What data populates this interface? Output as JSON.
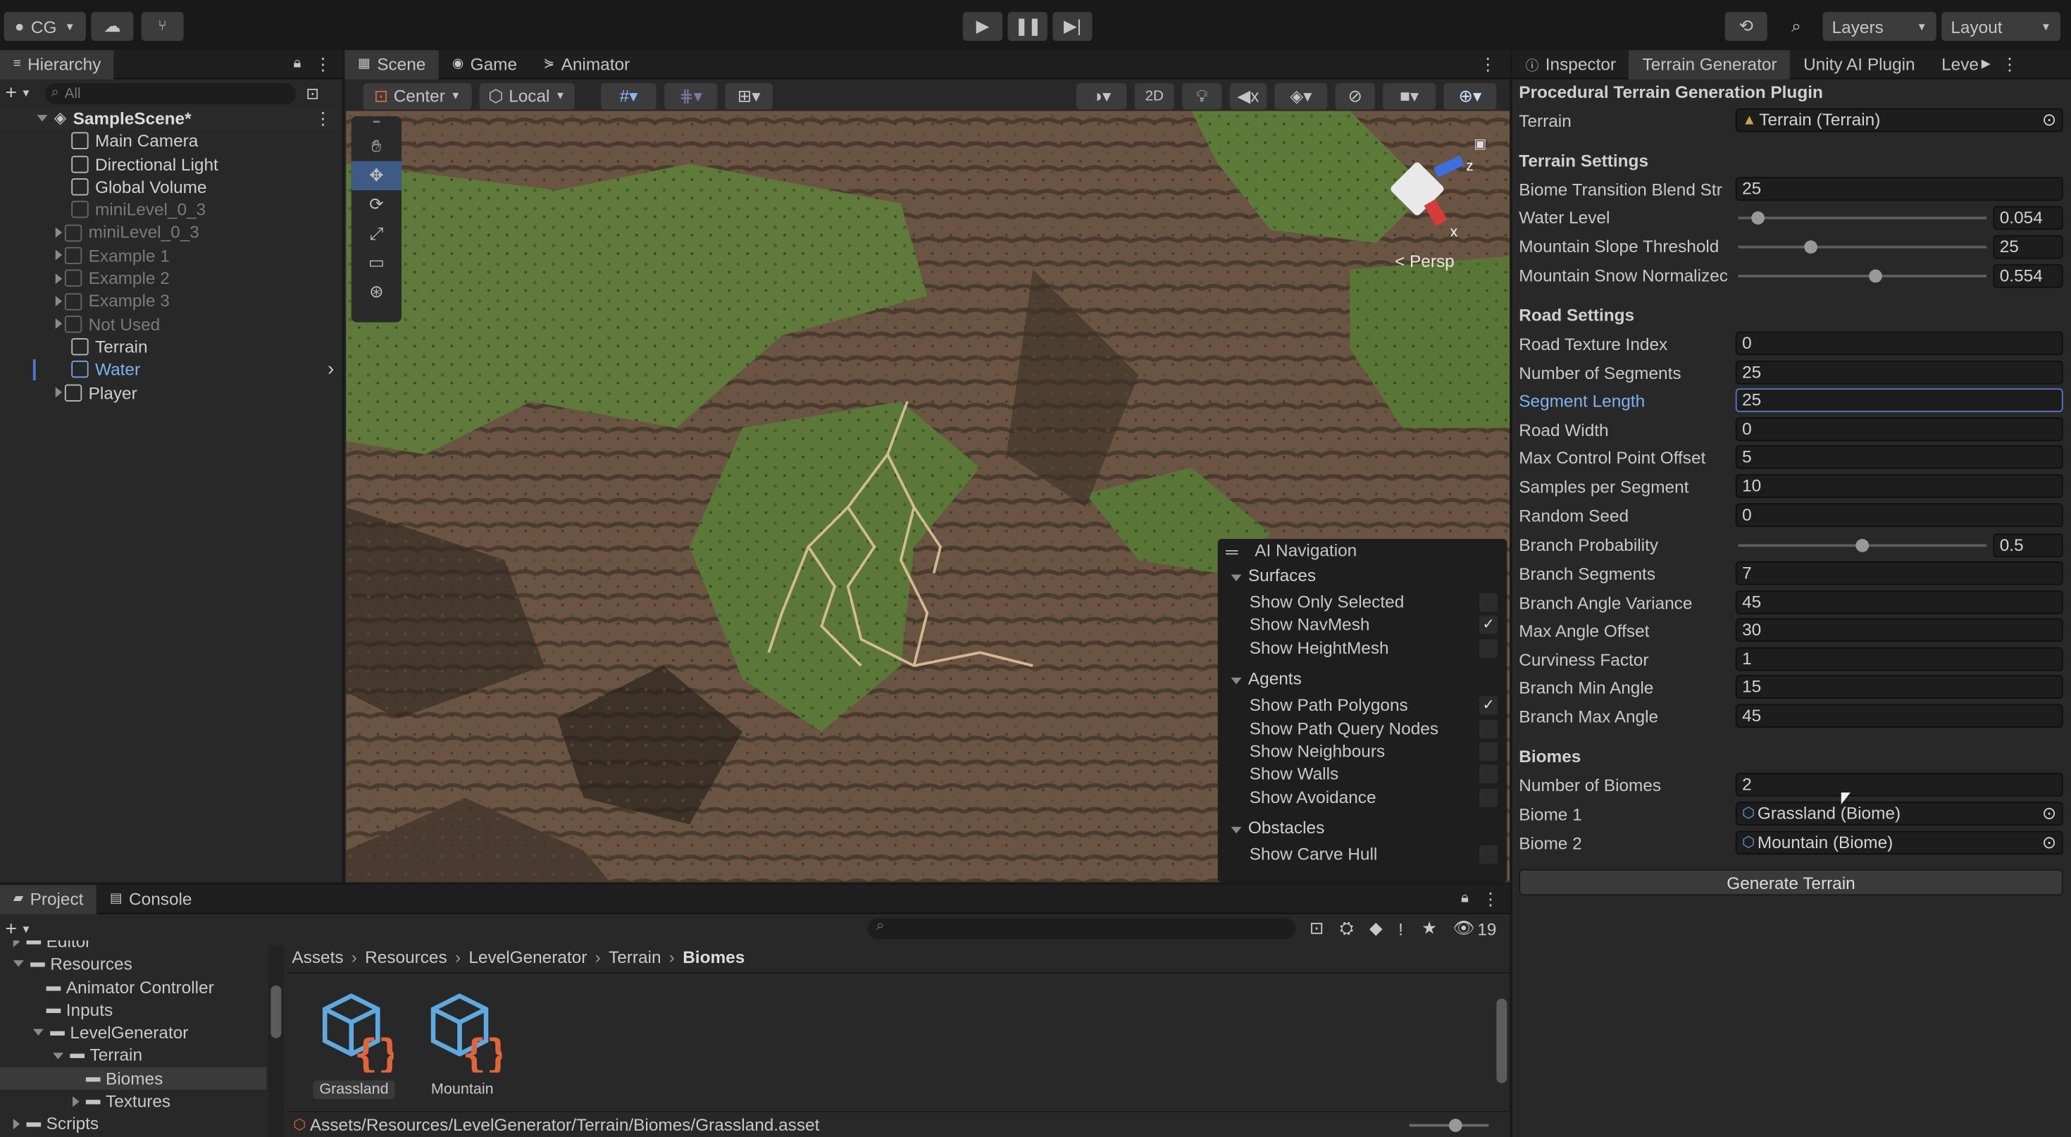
{
  "top": {
    "account": "CG",
    "layers": "Layers",
    "layout": "Layout"
  },
  "hierarchy": {
    "tab": "Hierarchy",
    "search_placeholder": "All",
    "scene": "SampleScene*",
    "items": [
      {
        "label": "Main Camera",
        "dim": false,
        "indent": 1,
        "arrow": false
      },
      {
        "label": "Directional Light",
        "dim": false,
        "indent": 1,
        "arrow": false
      },
      {
        "label": "Global Volume",
        "dim": false,
        "indent": 1,
        "arrow": false
      },
      {
        "label": "miniLevel_0_3",
        "dim": true,
        "indent": 1,
        "arrow": false
      },
      {
        "label": "miniLevel_0_3",
        "dim": true,
        "indent": 1,
        "arrow": true
      },
      {
        "label": "Example 1",
        "dim": true,
        "indent": 1,
        "arrow": true
      },
      {
        "label": "Example 2",
        "dim": true,
        "indent": 1,
        "arrow": true
      },
      {
        "label": "Example 3",
        "dim": true,
        "indent": 1,
        "arrow": true
      },
      {
        "label": "Not Used",
        "dim": true,
        "indent": 1,
        "arrow": true
      },
      {
        "label": "Terrain",
        "dim": false,
        "indent": 1,
        "arrow": false
      },
      {
        "label": "Water",
        "dim": false,
        "indent": 1,
        "arrow": false,
        "selected": true
      },
      {
        "label": "Player",
        "dim": false,
        "indent": 1,
        "arrow": true
      }
    ]
  },
  "scene_tabs": [
    "Scene",
    "Game",
    "Animator"
  ],
  "scene_toolbar": {
    "pivot": "Center",
    "space": "Local",
    "mode2d": "2D"
  },
  "gizmo": {
    "persp": "< Persp",
    "x": "x",
    "z": "z"
  },
  "ai_nav": {
    "title": "AI Navigation",
    "surfaces": {
      "label": "Surfaces",
      "items": [
        {
          "label": "Show Only Selected",
          "checked": false
        },
        {
          "label": "Show NavMesh",
          "checked": true
        },
        {
          "label": "Show HeightMesh",
          "checked": false
        }
      ]
    },
    "agents": {
      "label": "Agents",
      "items": [
        {
          "label": "Show Path Polygons",
          "checked": true
        },
        {
          "label": "Show Path Query Nodes",
          "checked": false
        },
        {
          "label": "Show Neighbours",
          "checked": false
        },
        {
          "label": "Show Walls",
          "checked": false
        },
        {
          "label": "Show Avoidance",
          "checked": false
        }
      ]
    },
    "obstacles": {
      "label": "Obstacles",
      "items": [
        {
          "label": "Show Carve Hull",
          "checked": false
        }
      ]
    }
  },
  "inspector": {
    "tabs": [
      "Inspector",
      "Terrain Generator",
      "Unity AI Plugin",
      "Leve"
    ],
    "plugin_title": "Procedural Terrain Generation Plugin",
    "terrain_label": "Terrain",
    "terrain_value": "Terrain (Terrain)",
    "terrain_settings": "Terrain Settings",
    "biome_blend_label": "Biome Transition Blend Str",
    "biome_blend_value": "25",
    "water_label": "Water Level",
    "water_value": "0.054",
    "water_frac": 0.054,
    "slope_label": "Mountain Slope Threshold",
    "slope_value": "25",
    "slope_frac": 0.28,
    "snow_label": "Mountain Snow Normalizec",
    "snow_value": "0.554",
    "snow_frac": 0.554,
    "road_settings": "Road Settings",
    "road_fields": [
      {
        "label": "Road Texture Index",
        "value": "0"
      },
      {
        "label": "Number of Segments",
        "value": "25"
      },
      {
        "label": "Segment Length",
        "value": "25",
        "active": true
      },
      {
        "label": "Road Width",
        "value": "0"
      },
      {
        "label": "Max Control Point Offset",
        "value": "5"
      },
      {
        "label": "Samples per Segment",
        "value": "10"
      },
      {
        "label": "Random Seed",
        "value": "0"
      }
    ],
    "branch_prob_label": "Branch Probability",
    "branch_prob_value": "0.5",
    "branch_prob_frac": 0.5,
    "branch_fields": [
      {
        "label": "Branch Segments",
        "value": "7"
      },
      {
        "label": "Branch Angle Variance",
        "value": "45"
      },
      {
        "label": "Max Angle Offset",
        "value": "30"
      },
      {
        "label": "Curviness Factor",
        "value": "1"
      },
      {
        "label": "Branch Min Angle",
        "value": "15"
      },
      {
        "label": "Branch Max Angle",
        "value": "45"
      }
    ],
    "biomes_title": "Biomes",
    "num_biomes_label": "Number of Biomes",
    "num_biomes_value": "2",
    "biome1_label": "Biome 1",
    "biome1_value": "Grassland (Biome)",
    "biome2_label": "Biome 2",
    "biome2_value": "Mountain (Biome)",
    "generate_button": "Generate Terrain"
  },
  "project": {
    "tabs": [
      "Project",
      "Console"
    ],
    "count": "19",
    "tree": [
      {
        "label": "Editor",
        "indent": 1,
        "open": false
      },
      {
        "label": "Resources",
        "indent": 1,
        "open": true
      },
      {
        "label": "Animator Controller",
        "indent": 2,
        "open": false
      },
      {
        "label": "Inputs",
        "indent": 2,
        "open": false
      },
      {
        "label": "LevelGenerator",
        "indent": 2,
        "open": true
      },
      {
        "label": "Terrain",
        "indent": 3,
        "open": true
      },
      {
        "label": "Biomes",
        "indent": 4,
        "open": false,
        "selected": true
      },
      {
        "label": "Textures",
        "indent": 4,
        "open": false
      },
      {
        "label": "Scripts",
        "indent": 1,
        "open": false
      }
    ],
    "breadcrumb": [
      "Assets",
      "Resources",
      "LevelGenerator",
      "Terrain",
      "Biomes"
    ],
    "assets": [
      {
        "label": "Grassland",
        "selected": true
      },
      {
        "label": "Mountain",
        "selected": false
      }
    ],
    "status_path": "Assets/Resources/LevelGenerator/Terrain/Biomes/Grassland.asset"
  },
  "colors": {
    "accent": "#4d78cc",
    "selected_row": "#2c5d87",
    "link_blue": "#7bb4f0",
    "asset_orange": "#e0653a",
    "asset_blue": "#5fa9e0"
  }
}
